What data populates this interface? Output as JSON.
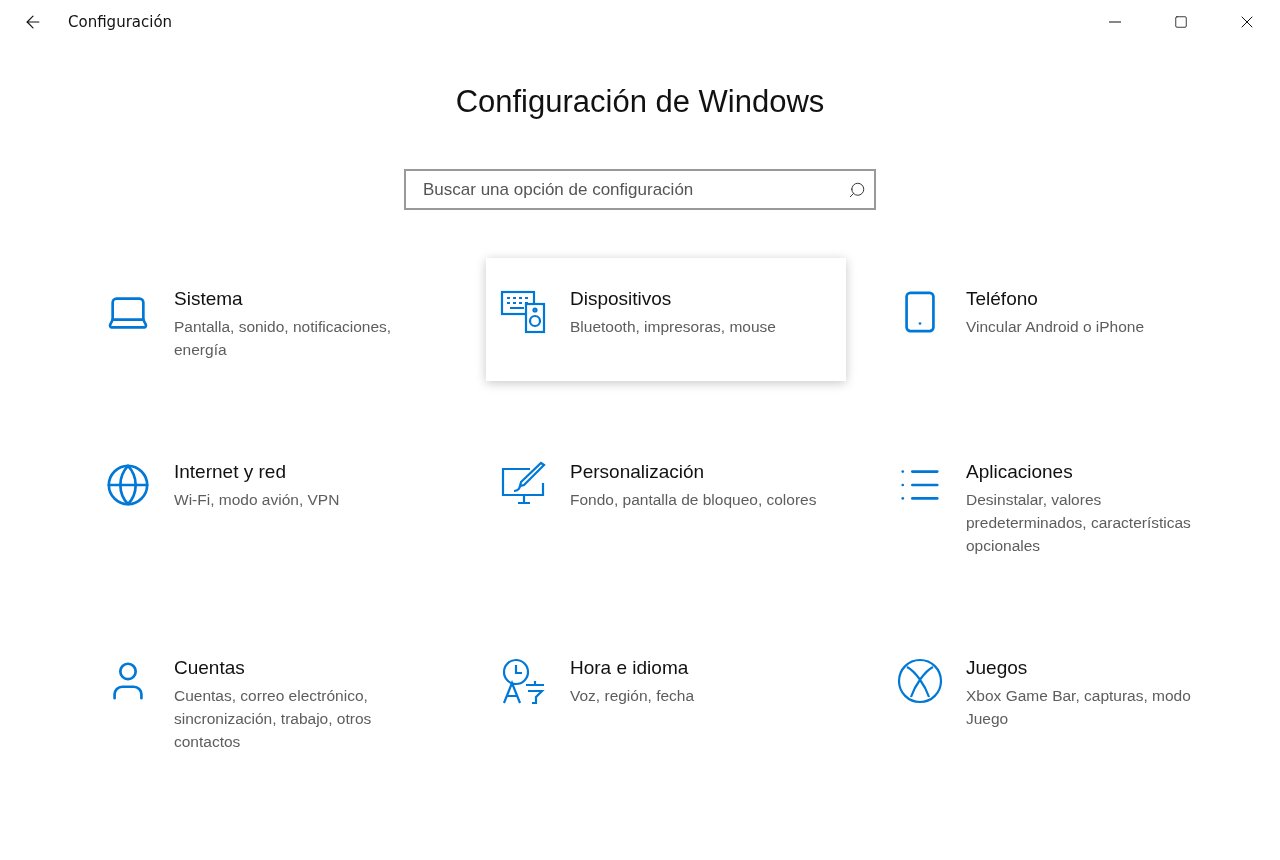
{
  "window": {
    "title": "Configuración"
  },
  "heading": "Configuración de Windows",
  "search": {
    "placeholder": "Buscar una opción de configuración"
  },
  "categories": [
    {
      "title": "Sistema",
      "description": "Pantalla, sonido, notificaciones, energía",
      "selected": false
    },
    {
      "title": "Dispositivos",
      "description": "Bluetooth, impresoras, mouse",
      "selected": true
    },
    {
      "title": "Teléfono",
      "description": "Vincular Android o iPhone",
      "selected": false
    },
    {
      "title": "Internet y red",
      "description": "Wi-Fi, modo avión, VPN",
      "selected": false
    },
    {
      "title": "Personalización",
      "description": "Fondo, pantalla de bloqueo, colores",
      "selected": false
    },
    {
      "title": "Aplicaciones",
      "description": "Desinstalar, valores predeterminados, características opcionales",
      "selected": false
    },
    {
      "title": "Cuentas",
      "description": "Cuentas, correo electrónico, sincronización, trabajo, otros contactos",
      "selected": false
    },
    {
      "title": "Hora e idioma",
      "description": "Voz, región, fecha",
      "selected": false
    },
    {
      "title": "Juegos",
      "description": "Xbox Game Bar, capturas, modo Juego",
      "selected": false
    }
  ]
}
